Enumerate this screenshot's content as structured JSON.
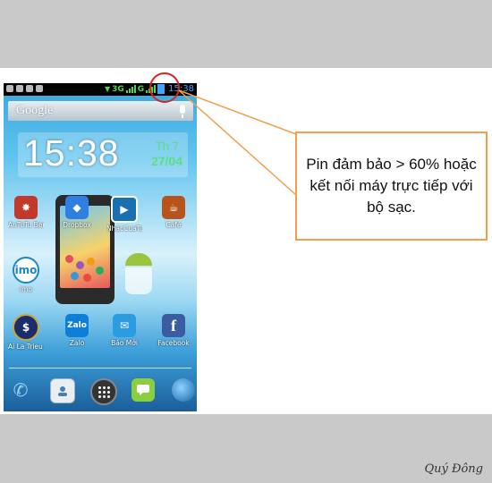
{
  "status_bar": {
    "network": "3G",
    "carrier_network": "G",
    "time": "15:38"
  },
  "search_widget": {
    "logo": "Google",
    "icon": "mic-icon"
  },
  "clock_widget": {
    "time": "15:38",
    "day": "Th 7",
    "date": "27/04"
  },
  "apps": [
    {
      "label": "AnTuTu Ben",
      "icon": "antutu-icon"
    },
    {
      "label": "Dropbox",
      "icon": "dropbox-icon"
    },
    {
      "label": "NhacCuaTui",
      "icon": "nhaccuatui-icon"
    },
    {
      "label": "Café",
      "icon": "cafe-icon"
    },
    {
      "label": "imo",
      "icon": "imo-icon"
    },
    {
      "label": "Ai La Trieu Pi",
      "icon": "millionaire-icon"
    },
    {
      "label": "Zalo",
      "icon": "zalo-icon"
    },
    {
      "label": "Báo Mới",
      "icon": "baomoi-icon"
    },
    {
      "label": "Facebook",
      "icon": "facebook-icon"
    }
  ],
  "app_icon_text": {
    "imo": "imo",
    "zalo": "Zalo",
    "facebook": "f"
  },
  "dock": [
    "phone-icon",
    "contacts-icon",
    "apps-icon",
    "sms-icon",
    "browser-icon"
  ],
  "callout": {
    "text": "Pin đảm bảo > 60% hoặc kết nối máy trực tiếp với bộ sạc."
  },
  "signature": "Quý Đông",
  "colors": {
    "highlight": "#d9241c",
    "callout_border": "#f0a04a",
    "clock_accent": "#5ce07a"
  }
}
